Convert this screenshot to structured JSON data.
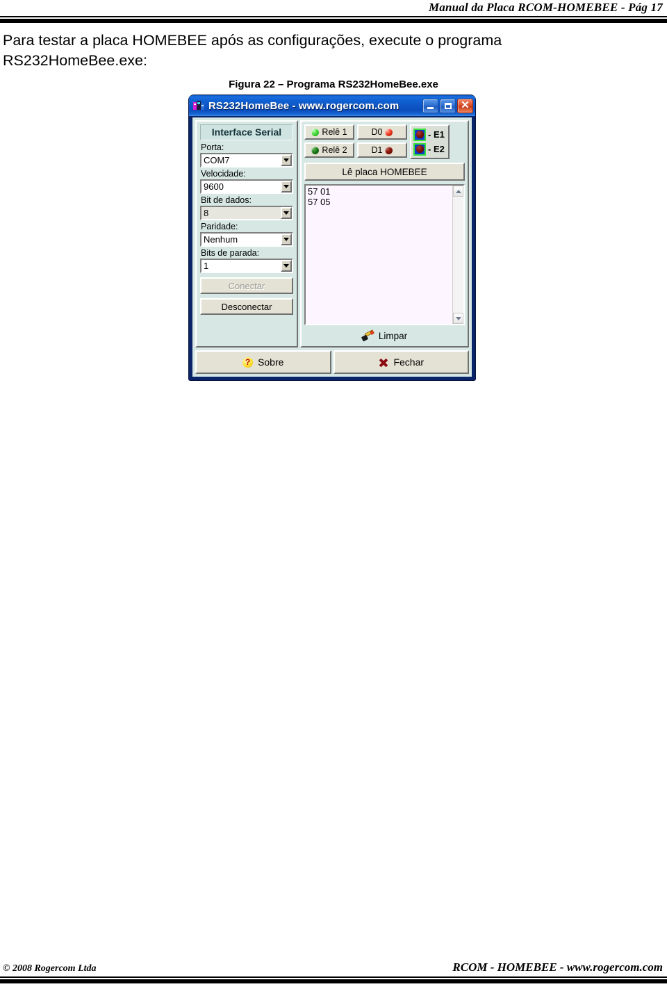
{
  "page_header": {
    "title": "Manual da Placa RCOM-HOMEBEE  -  Pág 17"
  },
  "body": {
    "paragraph_line1": "Para testar a placa HOMEBEE após as configurações, execute o programa",
    "paragraph_line2": "RS232HomeBee.exe:"
  },
  "figure": {
    "caption": "Figura 22 – Programa RS232HomeBee.exe"
  },
  "window": {
    "title": "RS232HomeBee - www.rogercom.com",
    "icon": "app-icon",
    "minimize_label": "_",
    "maximize_label": "□",
    "close_label": "✕"
  },
  "serial_panel": {
    "heading": "Interface Serial",
    "fields": [
      {
        "label": "Porta:",
        "value": "COM7",
        "disabled": false
      },
      {
        "label": "Velocidade:",
        "value": "9600",
        "disabled": false
      },
      {
        "label": "Bit de dados:",
        "value": "8",
        "disabled": true
      },
      {
        "label": "Paridade:",
        "value": "Nenhum",
        "disabled": false
      },
      {
        "label": "Bits de parada:",
        "value": "1",
        "disabled": false
      }
    ],
    "connect_label": "Conectar",
    "connect_enabled": false,
    "disconnect_label": "Desconectar",
    "disconnect_enabled": true
  },
  "io_panel": {
    "relays": [
      {
        "label": "Relê 1",
        "led": "green-on"
      },
      {
        "label": "Relê 2",
        "led": "green-off"
      }
    ],
    "digitals": [
      {
        "label": "D0",
        "led": "red-on"
      },
      {
        "label": "D1",
        "led": "red-off"
      }
    ],
    "inputs": [
      {
        "label": "- E1",
        "led": "red-off"
      },
      {
        "label": "- E2",
        "led": "red-off"
      }
    ],
    "read_button": "Lê placa HOMEBEE",
    "log_text": "57 01\n57 05",
    "clear_label": "Limpar",
    "clear_icon": "eraser-icon"
  },
  "footer_buttons": {
    "about_label": "Sobre",
    "about_icon": "question-icon",
    "close_label": "Fechar",
    "close_icon": "x-icon"
  },
  "page_footer": {
    "left": "© 2008 Rogercom Ltda",
    "right": "RCOM - HOMEBEE - www.rogercom.com"
  },
  "colors": {
    "titlebar_blue": "#0e56c6",
    "window_frame": "#0a246a",
    "client_bg": "#d6e7e4",
    "button_face": "#e4e2d4",
    "log_bg": "#fdf5ff",
    "led_green": "#4ede3f",
    "led_red": "#f5452b",
    "input_box_blue": "#0f3cc8",
    "input_box_border": "#39e23a"
  }
}
